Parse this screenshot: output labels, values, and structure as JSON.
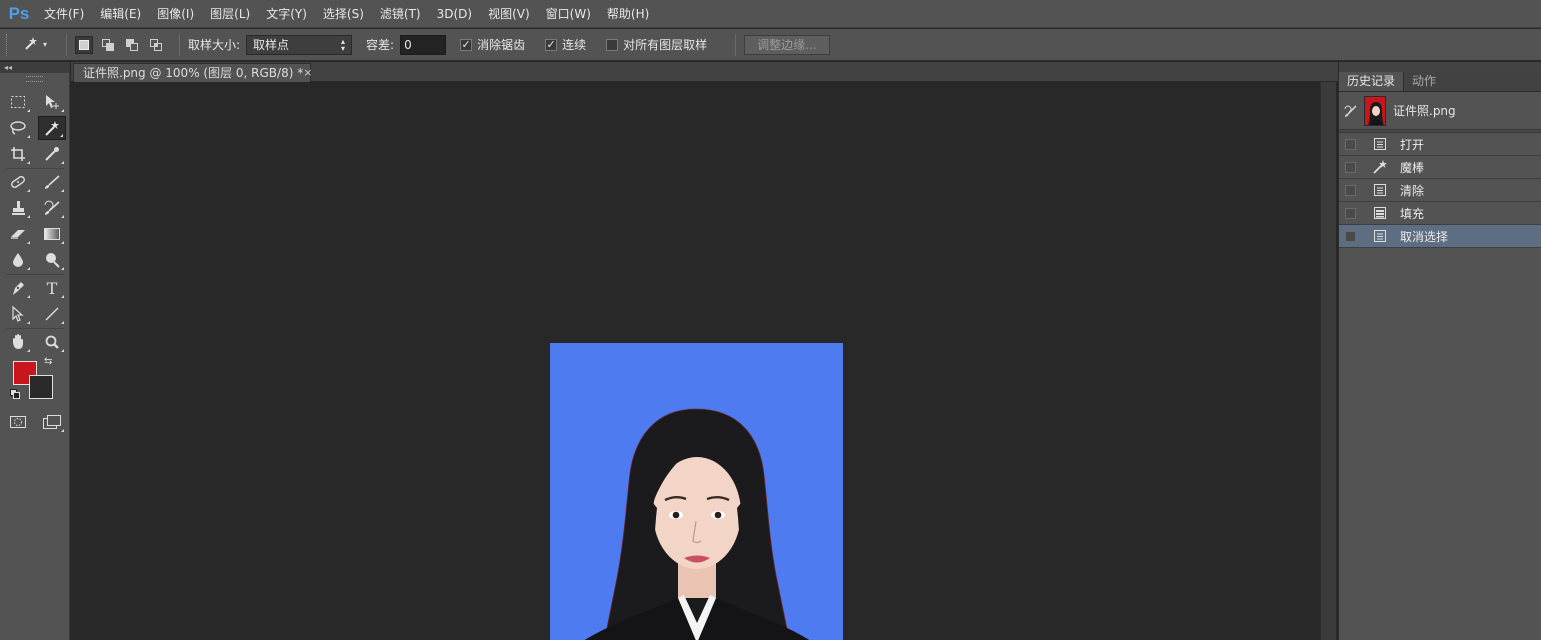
{
  "app": {
    "logo": "Ps",
    "menu": [
      "文件(F)",
      "编辑(E)",
      "图像(I)",
      "图层(L)",
      "文字(Y)",
      "选择(S)",
      "滤镜(T)",
      "3D(D)",
      "视图(V)",
      "窗口(W)",
      "帮助(H)"
    ]
  },
  "options": {
    "sample_size_label": "取样大小:",
    "sample_size_value": "取样点",
    "tolerance_label": "容差:",
    "tolerance_value": "0",
    "anti_alias_label": "消除锯齿",
    "anti_alias_checked": true,
    "contiguous_label": "连续",
    "contiguous_checked": true,
    "sample_all_layers_label": "对所有图层取样",
    "sample_all_layers_checked": false,
    "refine_edge_label": "调整边缘..."
  },
  "toolbar": {
    "collapse_label": "◂◂",
    "foreground_color": "#c8161c",
    "background_color": "#2a2a2a"
  },
  "document": {
    "tab_title": "证件照.png @ 100% (图层 0, RGB/8) *",
    "close_glyph": "×",
    "background_color": "#4e7cf0"
  },
  "panel": {
    "tabs": [
      "历史记录",
      "动作"
    ],
    "active_tab": 0,
    "snapshot_name": "证件照.png",
    "history": [
      {
        "label": "打开",
        "icon": "document-icon",
        "selected": false
      },
      {
        "label": "魔棒",
        "icon": "magic-wand-icon",
        "selected": false
      },
      {
        "label": "清除",
        "icon": "document-icon",
        "selected": false
      },
      {
        "label": "填充",
        "icon": "fill-icon",
        "selected": false
      },
      {
        "label": "取消选择",
        "icon": "document-icon",
        "selected": true
      }
    ]
  },
  "colors": {
    "chrome": "#535353",
    "canvas": "#282828",
    "selection": "#5d6d82",
    "ps_blue": "#4ea0e8"
  }
}
